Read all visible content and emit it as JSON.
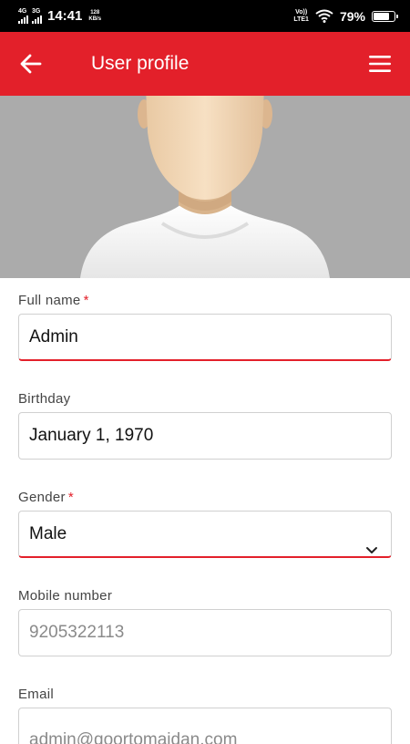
{
  "status_bar": {
    "net1": "4G",
    "net2": "3G",
    "time": "14:41",
    "speed_value": "128",
    "speed_unit": "KB/s",
    "volte_top": "Vo))",
    "volte_bottom": "LTE1",
    "battery": "79%"
  },
  "app_bar": {
    "title": "User profile",
    "back_icon": "arrow-left-icon",
    "menu_icon": "hamburger-menu-icon",
    "color": "#e3202a"
  },
  "form": {
    "full_name": {
      "label": "Full name",
      "required_mark": "*",
      "value": "Admin"
    },
    "birthday": {
      "label": "Birthday",
      "value": "January 1, 1970"
    },
    "gender": {
      "label": "Gender",
      "required_mark": "*",
      "value": "Male"
    },
    "mobile": {
      "label": "Mobile number",
      "placeholder": "9205322113"
    },
    "email": {
      "label": "Email",
      "value": "admin@qoortomaidan.com"
    }
  }
}
